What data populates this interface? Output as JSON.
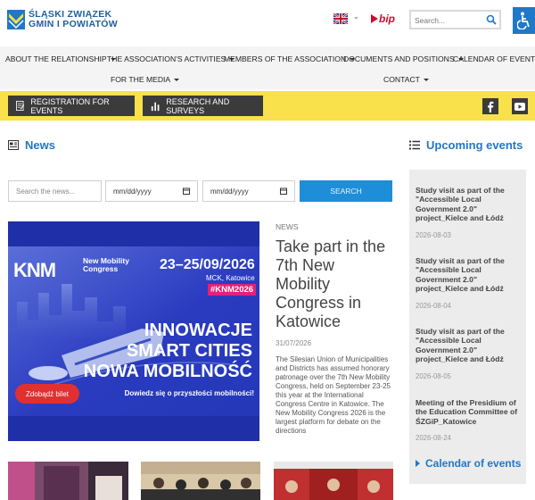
{
  "header": {
    "logo_line1": "ŚLĄSKI ZWIĄZEK",
    "logo_line2": "GMIN I POWIATÓW",
    "bip": "bip",
    "search_placeholder": "Search...",
    "colors": {
      "brand_blue": "#1f5fa0",
      "accent_blue": "#1f78c8",
      "yellow": "#f8e14a",
      "dark": "#3b3b3b"
    }
  },
  "nav": {
    "items": [
      {
        "label": "ABOUT THE RELATIONSHIP"
      },
      {
        "label": "THE ASSOCIATION'S ACTIVITIES"
      },
      {
        "label": "MEMBERS OF THE ASSOCIATION"
      },
      {
        "label": "DOCUMENTS AND POSITIONS"
      },
      {
        "label": "CALENDAR OF EVENTS"
      },
      {
        "label": "FOR THE MEDIA"
      },
      {
        "label": "CONTACT"
      }
    ]
  },
  "actions": {
    "registration": "REGISTRATION FOR EVENTS",
    "research": "RESEARCH AND SURVEYS"
  },
  "news": {
    "heading": "News",
    "search_placeholder": "Search the news...",
    "date_from": "mm/dd/yyyy",
    "date_to": "mm/dd/yyyy",
    "search_button": "SEARCH",
    "featured": {
      "category": "NEWS",
      "title": "Take part in the 7th New Mobility Congress in Katowice",
      "date": "31/07/2026",
      "excerpt": "The Silesian Union of Municipalities and Districts has assumed honorary patronage over the 7th New Mobility Congress, held on September 23-25 this year at the International Congress Centre in Katowice. The New Mobility Congress 2026 is the largest platform for debate on the directions",
      "image": {
        "logo": "KNM",
        "event_name": "New Mobility Congress",
        "dates": "23–25/09/2026",
        "venue": "MCK, Katowice",
        "hashtag": "#KNM2026",
        "line1": "INNOWACJE",
        "line2": "SMART CITIES",
        "line3": "NOWA MOBILNOŚĆ",
        "cta": "Zdobądź bilet",
        "tagline": "Dowiedz się o przyszłości mobilności!"
      }
    }
  },
  "sidebar": {
    "heading": "Upcoming events",
    "events": [
      {
        "title": "Study visit as part of the \"Accessible Local Government 2.0\" project_Kielce and Łódź",
        "date": "2026-08-03"
      },
      {
        "title": "Study visit as part of the \"Accessible Local Government 2.0\" project_Kielce and Łódź",
        "date": "2026-08-04"
      },
      {
        "title": "Study visit as part of the \"Accessible Local Government 2.0\" project_Kielce and Łódź",
        "date": "2026-08-05"
      },
      {
        "title": "Meeting of the Presidium of the Education Committee of ŚZGiP_Katowice",
        "date": "2026-08-24"
      }
    ],
    "calendar_link": "Calendar of events"
  }
}
